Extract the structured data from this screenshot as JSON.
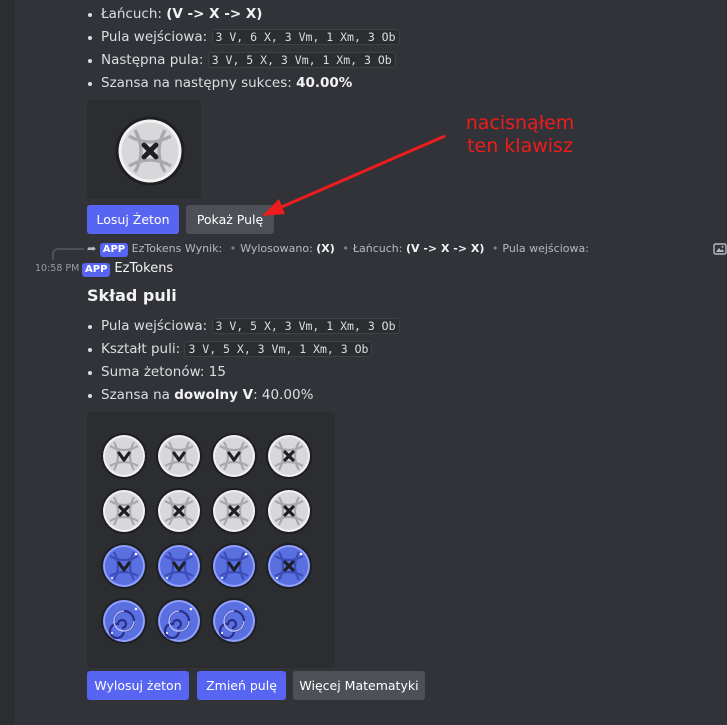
{
  "message1": {
    "lines": [
      {
        "label": "Łańcuch: ",
        "bold": "(V -> X -> X)"
      },
      {
        "label": "Pula wejściowa: ",
        "code": "3 V, 6 X, 3 Vm, 1 Xm, 3 Ob"
      },
      {
        "label": "Następna pula: ",
        "code": "3 V, 5 X, 3 Vm, 1 Xm, 3 Ob"
      },
      {
        "label": "Szansa na następny sukces: ",
        "bold": "40.00%"
      }
    ],
    "token": "X",
    "buttons": {
      "draw": "Losuj Żeton",
      "show_pool": "Pokaż Pulę"
    }
  },
  "annotation": {
    "line1": "nacisnąłem",
    "line2": "ten klawisz",
    "color": "#ee1c1c"
  },
  "reply": {
    "tag": "APP",
    "name": "EzTokens",
    "result": "Wynik:",
    "drawn_label": "Wylosowano: ",
    "drawn_value": "(X)",
    "chain_label": "Łańcuch: ",
    "chain_value": "(V -> X -> X)",
    "pool_label": "Pula wejściowa: "
  },
  "message2": {
    "time": "10:58 PM",
    "tag": "APP",
    "author": "EzTokens",
    "title": "Skład puli",
    "lines": [
      {
        "label": "Pula wejściowa: ",
        "code": "3 V, 5 X, 3 Vm, 1 Xm, 3 Ob"
      },
      {
        "label": "Kształt puli: ",
        "code": "3 V, 5 X, 3 Vm, 1 Xm, 3 Ob"
      },
      {
        "label": "Suma żetonów: ",
        "value": "15"
      },
      {
        "label": "Szansa na ",
        "bold": "dowolny V",
        "suffix": ": 40.00%"
      }
    ],
    "tokens": [
      "V",
      "V",
      "V",
      "X",
      "X",
      "X",
      "X",
      "X",
      "Vm",
      "Vm",
      "Vm",
      "Xm",
      "Ob",
      "Ob",
      "Ob"
    ],
    "buttons": {
      "draw": "Wylosuj żeton",
      "change": "Zmień pulę",
      "more": "Więcej Matematyki"
    }
  },
  "colors": {
    "accent": "#5865f2",
    "secondary": "#4e5058",
    "background": "#323339"
  }
}
